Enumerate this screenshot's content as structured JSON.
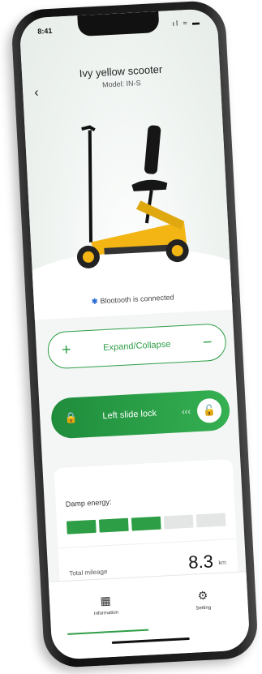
{
  "status": {
    "time": "8:41",
    "icons": "ıl ≈ ▬"
  },
  "header": {
    "title": "Ivy yellow scooter",
    "model": "Model: IN-S",
    "back_glyph": "‹"
  },
  "device": {
    "image_alt": "yellow folding scooter",
    "bluetooth_text": "Blootooth is connected",
    "bluetooth_glyph": "✱"
  },
  "expand": {
    "label": "Expand/Collapse",
    "plus": "+",
    "minus": "−"
  },
  "lock": {
    "label": "Left slide lock",
    "arrows": "‹‹‹",
    "pad_icon": "🔒",
    "knob_icon": "🔓"
  },
  "energy": {
    "label": "Damp energy:",
    "level": 3,
    "segments": 5
  },
  "total": {
    "label": "Total mileage",
    "value": "8.3",
    "unit": "km"
  },
  "tabs": [
    {
      "label": "Information",
      "icon": "▦"
    },
    {
      "label": "Setting",
      "icon": "⚙"
    }
  ],
  "colors": {
    "accent": "#2e9e46",
    "scooter_yellow": "#f2b514"
  }
}
